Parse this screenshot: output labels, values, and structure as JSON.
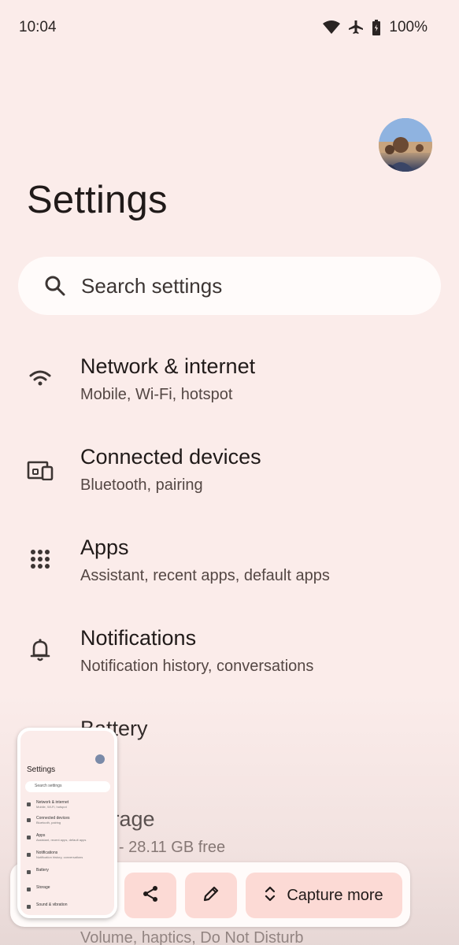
{
  "status_bar": {
    "time": "10:04",
    "battery": "100%",
    "icons": [
      "wifi-icon",
      "airplane-icon",
      "battery-icon"
    ]
  },
  "header": {
    "title": "Settings"
  },
  "search": {
    "placeholder": "Search settings"
  },
  "settings_items": [
    {
      "title": "Network & internet",
      "subtitle": "Mobile, Wi-Fi, hotspot",
      "icon": "wifi-icon"
    },
    {
      "title": "Connected devices",
      "subtitle": "Bluetooth, pairing",
      "icon": "devices-icon"
    },
    {
      "title": "Apps",
      "subtitle": "Assistant, recent apps, default apps",
      "icon": "apps-grid-icon"
    },
    {
      "title": "Notifications",
      "subtitle": "Notification history, conversations",
      "icon": "bell-icon"
    },
    {
      "title": "Battery",
      "subtitle": "%",
      "icon": "battery-icon"
    },
    {
      "title": "Storage",
      "subtitle": "used - 28.11 GB free",
      "icon": "storage-icon"
    },
    {
      "title": "Sound & vibration",
      "subtitle": "Volume, haptics, Do Not Disturb",
      "icon": "sound-icon"
    }
  ],
  "screenshot_toolbar": {
    "share_icon": "share-icon",
    "edit_icon": "edit-icon",
    "capture_more_label": "Capture more",
    "capture_more_icon": "expand-icon"
  },
  "colors": {
    "background": "#FBECEA",
    "search_bg": "#FFFBFA",
    "chip_bg": "#FCDAD5",
    "text_primary": "#201A19",
    "text_secondary": "#544744"
  }
}
